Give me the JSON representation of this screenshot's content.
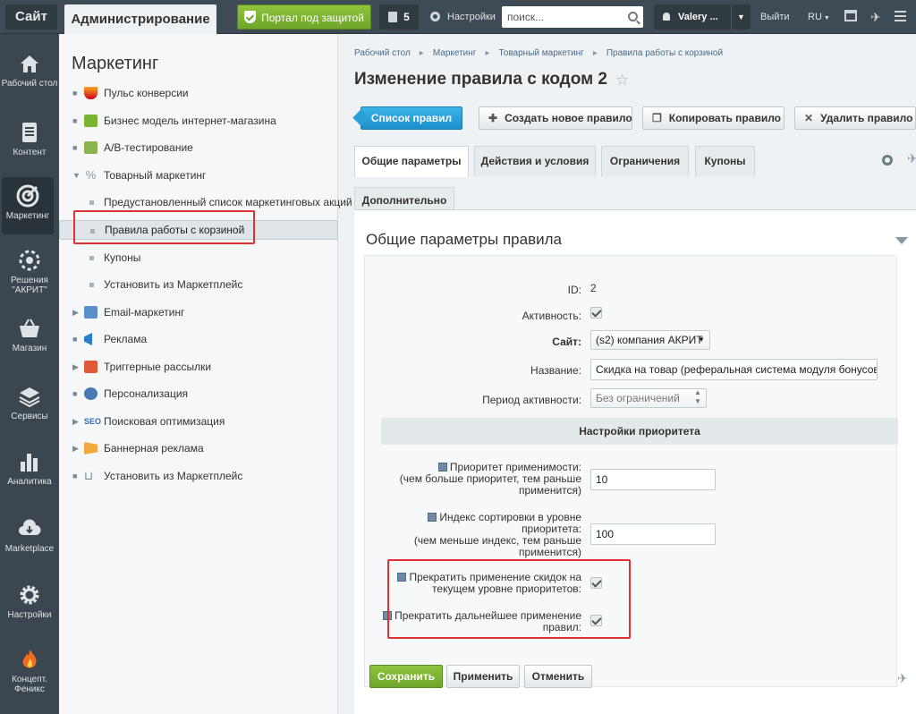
{
  "topbar": {
    "site_label": "Сайт",
    "admin_label": "Администрирование",
    "portal_label": "Портал под защитой",
    "notifications_count": "5",
    "settings_label": "Настройки",
    "search_placeholder": "поиск...",
    "user_name": "Valery ...",
    "exit_label": "Выйти",
    "lang_label": "RU"
  },
  "nav": [
    {
      "label": "Рабочий стол",
      "icon": "home-icon"
    },
    {
      "label": "Контент",
      "icon": "document-icon"
    },
    {
      "label": "Маркетинг",
      "icon": "target-icon",
      "active": true
    },
    {
      "label": "Решения \"АКРИТ\"",
      "icon": "solutions-icon"
    },
    {
      "label": "Магазин",
      "icon": "basket-icon"
    },
    {
      "label": "Сервисы",
      "icon": "layers-icon"
    },
    {
      "label": "Аналитика",
      "icon": "bar-chart-icon"
    },
    {
      "label": "Marketplace",
      "icon": "cloud-download-icon"
    },
    {
      "label": "Настройки",
      "icon": "gear-icon"
    },
    {
      "label": "Концепт. Феникс",
      "icon": "flame-icon"
    }
  ],
  "menu": {
    "title": "Маркетинг",
    "items": [
      {
        "label": "Пульс конверсии"
      },
      {
        "label": "Бизнес модель интернет-магазина"
      },
      {
        "label": "A/B-тестирование"
      },
      {
        "label": "Товарный маркетинг"
      },
      {
        "label": "Предустановленный список маркетинговых акций"
      },
      {
        "label": "Правила работы с корзиной"
      },
      {
        "label": "Купоны"
      },
      {
        "label": "Установить из Маркетплейс"
      },
      {
        "label": "Email-маркетинг"
      },
      {
        "label": "Реклама"
      },
      {
        "label": "Триггерные рассылки"
      },
      {
        "label": "Персонализация"
      },
      {
        "label": "Поисковая оптимизация"
      },
      {
        "label": "Баннерная реклама"
      },
      {
        "label": "Установить из Маркетплейс"
      }
    ]
  },
  "breadcrumbs": [
    "Рабочий стол",
    "Маркетинг",
    "Товарный маркетинг",
    "Правила работы с корзиной"
  ],
  "page_title": "Изменение правила с кодом 2",
  "toolbar": {
    "list_label": "Список правил",
    "create_label": "Создать новое правило",
    "copy_label": "Копировать правило",
    "delete_label": "Удалить правило"
  },
  "tabs": [
    "Общие параметры",
    "Действия и условия",
    "Ограничения",
    "Купоны",
    "Дополнительно"
  ],
  "section_title": "Общие параметры правила",
  "form": {
    "id_label": "ID:",
    "id_value": "2",
    "active_label": "Активность:",
    "active_checked": true,
    "site_label": "Сайт:",
    "site_value": "(s2) компания АКРИТ",
    "name_label": "Название:",
    "name_value": "Скидка на товар (реферальная система модуля бонусов)",
    "period_label": "Период активности:",
    "period_value": "Без ограничений",
    "priority_header": "Настройки приоритета",
    "priority_label_1": "Приоритет применимости:",
    "priority_label_2": "(чем больше приоритет, тем раньше",
    "priority_label_3": "применится)",
    "priority_value": "10",
    "sort_label_1": "Индекс сортировки в уровне",
    "sort_label_2": "приоритета:",
    "sort_label_3": "(чем меньше индекс, тем раньше",
    "sort_label_4": "применится)",
    "sort_value": "100",
    "stop_level_label_1": "Прекратить применение скидок на",
    "stop_level_label_2": "текущем уровне приоритетов:",
    "stop_level_checked": true,
    "stop_further_label_1": "Прекратить дальнейшее применение",
    "stop_further_label_2": "правил:",
    "stop_further_checked": true
  },
  "footer": {
    "save_label": "Сохранить",
    "apply_label": "Применить",
    "cancel_label": "Отменить"
  },
  "colors": {
    "accent_green": "#7ab532",
    "accent_blue": "#2aa0da",
    "highlight_red": "#e03030",
    "topbar": "#3f4b54"
  }
}
